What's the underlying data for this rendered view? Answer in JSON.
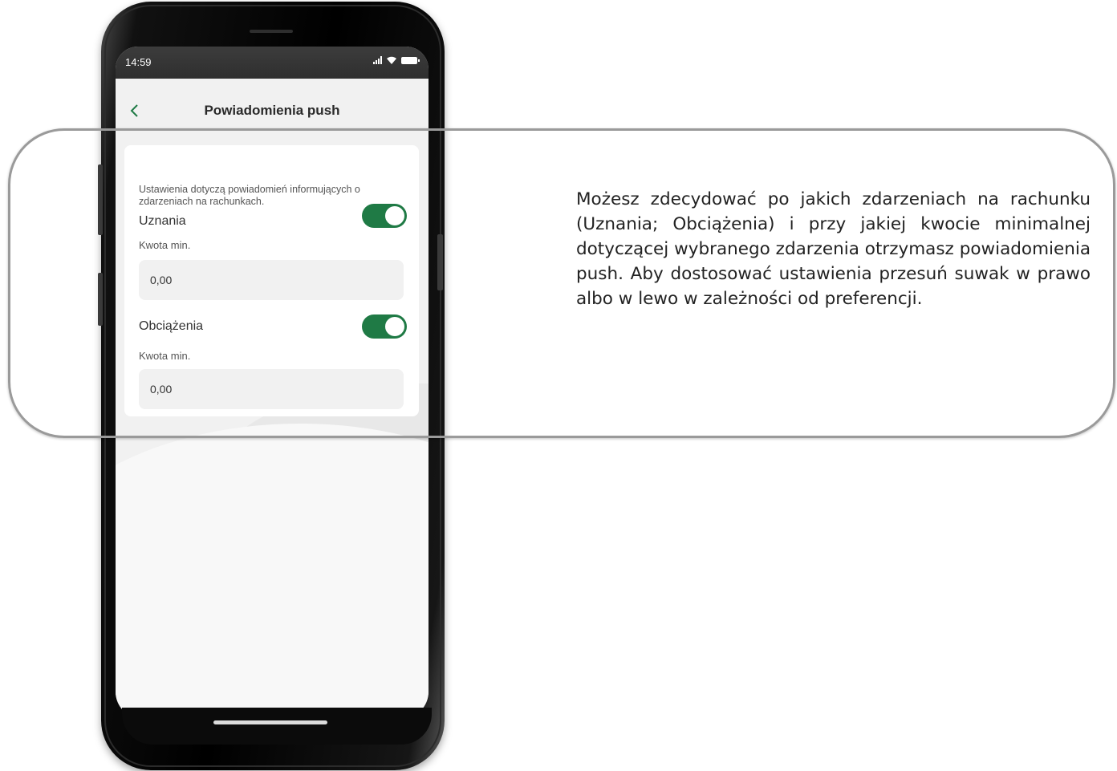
{
  "status_bar": {
    "time": "14:59"
  },
  "header": {
    "back_icon": "chevron-left-icon",
    "title": "Powiadomienia push"
  },
  "card": {
    "info": "Ustawienia dotyczą powiadomień informujących o zdarzeniach na rachunkach.",
    "rows": [
      {
        "label": "Uznania",
        "toggle_on": true,
        "amount_label": "Kwota min.",
        "amount_value": "0,00"
      },
      {
        "label": "Obciążenia",
        "toggle_on": true,
        "amount_label": "Kwota min.",
        "amount_value": "0,00"
      }
    ]
  },
  "colors": {
    "accent": "#1f7a45",
    "callout_border": "#9a9a9a"
  },
  "description": "Możesz zdecydować po jakich zdarzeniach na rachunku (Uznania; Obciążenia) i przy jakiej kwocie minimalnej dotyczącej wybranego zdarzenia otrzymasz powiadomienia push. Aby dostosować ustawienia przesuń suwak w prawo albo w lewo w zależności od preferencji."
}
